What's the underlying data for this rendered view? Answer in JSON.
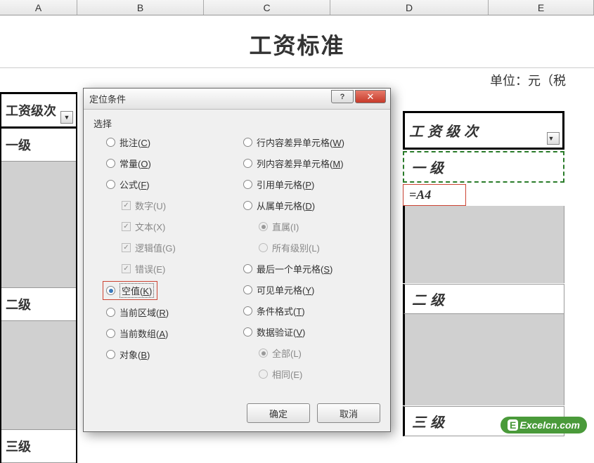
{
  "columns": [
    "A",
    "B",
    "C",
    "D",
    "E"
  ],
  "sheet": {
    "title": "工资标准",
    "subtitle": "单位：元（税",
    "left_header": "工资级次",
    "right_header": "工资级次",
    "levels": [
      "一级",
      "二级",
      "三级"
    ],
    "right_levels": [
      "一级",
      "二级",
      "三级"
    ],
    "formula": "=A4"
  },
  "dialog": {
    "title": "定位条件",
    "help": "?",
    "close": "✕",
    "fieldset": "选择",
    "left_options": [
      {
        "type": "radio",
        "label": "批注(",
        "u": "C",
        "after": ")"
      },
      {
        "type": "radio",
        "label": "常量(",
        "u": "O",
        "after": ")"
      },
      {
        "type": "radio",
        "label": "公式(",
        "u": "F",
        "after": ")"
      },
      {
        "type": "check",
        "indent": true,
        "disabled": true,
        "checked": true,
        "label": "数字(U)"
      },
      {
        "type": "check",
        "indent": true,
        "disabled": true,
        "checked": true,
        "label": "文本(X)"
      },
      {
        "type": "check",
        "indent": true,
        "disabled": true,
        "checked": true,
        "label": "逻辑值(G)"
      },
      {
        "type": "check",
        "indent": true,
        "disabled": true,
        "checked": true,
        "label": "错误(E)"
      },
      {
        "type": "radio",
        "checked": true,
        "highlight": true,
        "label": "空值(",
        "u": "K",
        "after": ")"
      },
      {
        "type": "radio",
        "label": "当前区域(",
        "u": "R",
        "after": ")"
      },
      {
        "type": "radio",
        "label": "当前数组(",
        "u": "A",
        "after": ")"
      },
      {
        "type": "radio",
        "label": "对象(",
        "u": "B",
        "after": ")"
      }
    ],
    "right_options": [
      {
        "type": "radio",
        "label": "行内容差异单元格(",
        "u": "W",
        "after": ")"
      },
      {
        "type": "radio",
        "label": "列内容差异单元格(",
        "u": "M",
        "after": ")"
      },
      {
        "type": "radio",
        "label": "引用单元格(",
        "u": "P",
        "after": ")"
      },
      {
        "type": "radio",
        "label": "从属单元格(",
        "u": "D",
        "after": ")"
      },
      {
        "type": "radio",
        "indent": true,
        "disabled": true,
        "checked": true,
        "label": "直属(I)"
      },
      {
        "type": "radio",
        "indent": true,
        "disabled": true,
        "label": "所有级别(L)"
      },
      {
        "type": "radio",
        "label": "最后一个单元格(",
        "u": "S",
        "after": ")"
      },
      {
        "type": "radio",
        "label": "可见单元格(",
        "u": "Y",
        "after": ")"
      },
      {
        "type": "radio",
        "label": "条件格式(",
        "u": "T",
        "after": ")"
      },
      {
        "type": "radio",
        "label": "数据验证(",
        "u": "V",
        "after": ")"
      },
      {
        "type": "radio",
        "indent": true,
        "disabled": true,
        "checked": true,
        "label": "全部(L)"
      },
      {
        "type": "radio",
        "indent": true,
        "disabled": true,
        "label": "相同(E)"
      }
    ],
    "ok": "确定",
    "cancel": "取消"
  },
  "watermark": {
    "badge": "E",
    "text": "Excelcn.com"
  }
}
